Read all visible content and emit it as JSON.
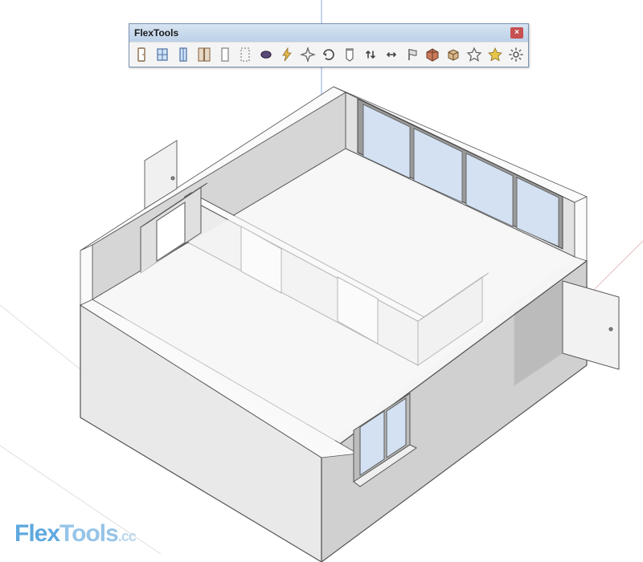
{
  "toolbar": {
    "title": "FlexTools",
    "close_glyph": "×",
    "buttons": [
      {
        "name": "flex-door-icon",
        "tip": "FlexDoor"
      },
      {
        "name": "flex-window-icon",
        "tip": "FlexWindow"
      },
      {
        "name": "flex-glass-door-icon",
        "tip": "FlexGlassDoor"
      },
      {
        "name": "flex-double-door-icon",
        "tip": "FlexDoubleDoor"
      },
      {
        "name": "flex-panel-icon",
        "tip": "FlexPanel"
      },
      {
        "name": "flex-blank-icon",
        "tip": "FlexBlank"
      },
      {
        "name": "flex-lens-icon",
        "tip": "FlexLens"
      },
      {
        "name": "zap-icon",
        "tip": "Zap"
      },
      {
        "name": "sparkle-icon",
        "tip": "ConvertToFlex"
      },
      {
        "name": "refresh-icon",
        "tip": "Reload"
      },
      {
        "name": "flex-note-icon",
        "tip": "FlexNote"
      },
      {
        "name": "raise-lower-icon",
        "tip": "RaiseLower"
      },
      {
        "name": "expand-icon",
        "tip": "Expand"
      },
      {
        "name": "flag-icon",
        "tip": "Flag"
      },
      {
        "name": "wall-cutter-icon",
        "tip": "WallCutter"
      },
      {
        "name": "box-tool-icon",
        "tip": "BoxTool"
      },
      {
        "name": "star-outline-icon",
        "tip": "FavoriteOutline"
      },
      {
        "name": "star-icon",
        "tip": "Favorite"
      },
      {
        "name": "gear-icon",
        "tip": "Settings"
      }
    ]
  },
  "watermark": {
    "bold": "Flex",
    "rest": "Tools",
    "suffix": ".cc"
  },
  "scene": {
    "description": "3D isometric view of a small open-top building model with interior partition walls, one open door on the right exterior wall, several interior door openings, a large 4-panel sliding glass window on the rear wall, and a small window on the front wall. Blue vertical and red/green ground axis lines are visible.",
    "axes": {
      "z": "#3a6fd8",
      "ground1": "#7a7a7a",
      "ground2": "#c94a4a"
    },
    "glass_color": "#d3e1f2"
  }
}
